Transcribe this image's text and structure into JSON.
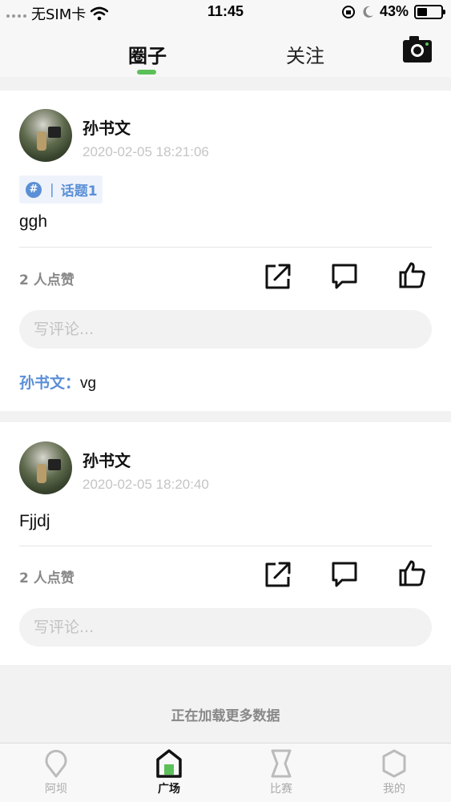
{
  "status_bar": {
    "carrier": "无SIM卡",
    "time": "11:45",
    "battery_percent": "43%",
    "battery_level": 0.43
  },
  "top_nav": {
    "tabs": [
      {
        "label": "圈子",
        "active": true
      },
      {
        "label": "关注",
        "active": false
      }
    ],
    "camera_icon": "camera-icon",
    "accent_color": "#5cc05a"
  },
  "posts": [
    {
      "author": "孙书文",
      "time": "2020-02-05 18:21:06",
      "topic": "话题1",
      "content": "ggh",
      "likes_text": "2 人点赞",
      "comment_placeholder": "写评论...",
      "comments": [
        {
          "author": "孙书文：",
          "text": "vg"
        }
      ]
    },
    {
      "author": "孙书文",
      "time": "2020-02-05 18:20:40",
      "content": "Fjjdj",
      "likes_text": "2 人点赞",
      "comment_placeholder": "写评论..."
    }
  ],
  "loading_text": "正在加载更多数据",
  "bottom_tabs": [
    {
      "label": "阿坝",
      "icon": "location-pin-icon",
      "active": false
    },
    {
      "label": "广场",
      "icon": "home-icon",
      "active": true
    },
    {
      "label": "比赛",
      "icon": "trophy-icon",
      "active": false
    },
    {
      "label": "我的",
      "icon": "profile-icon",
      "active": false
    }
  ],
  "colors": {
    "link_blue": "#5b8fd6",
    "timestamp_gray": "#c5c5c5"
  }
}
